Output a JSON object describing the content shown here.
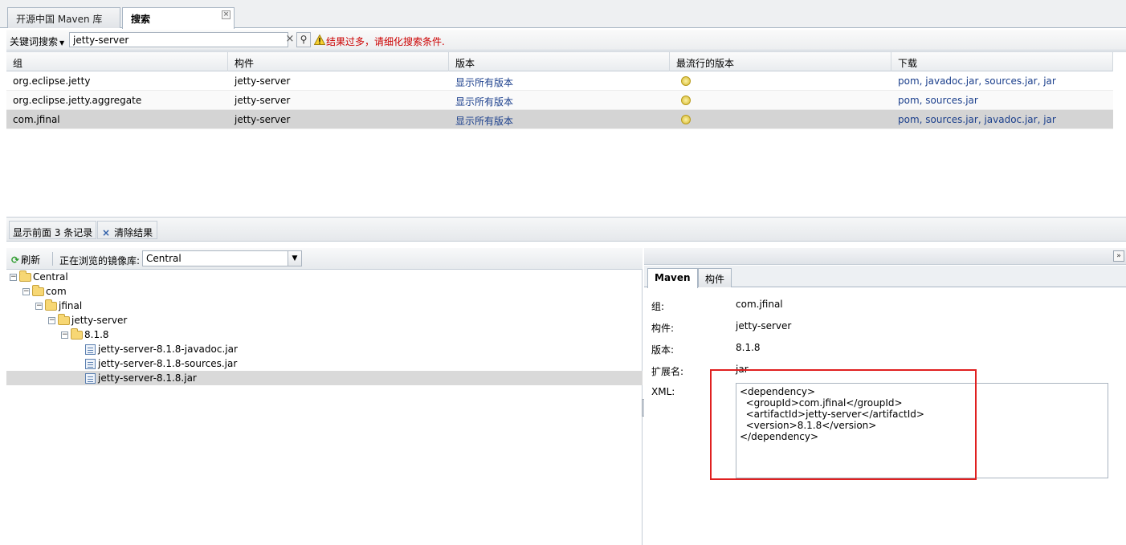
{
  "tabs": [
    {
      "label": "开源中国 Maven 库",
      "active": false
    },
    {
      "label": "搜索",
      "active": true
    }
  ],
  "search": {
    "type_label": "关键词搜索",
    "value": "jetty-server",
    "clear_icon": "×",
    "go_icon": "⚲",
    "warning": "结果过多，请细化搜索条件."
  },
  "grid": {
    "headers": [
      "组",
      "构件",
      "版本",
      "最流行的版本",
      "下载"
    ],
    "rows": [
      {
        "group": "org.eclipse.jetty",
        "artifact": "jetty-server",
        "versions": "显示所有版本",
        "downloads": "pom, javadoc.jar, sources.jar, jar"
      },
      {
        "group": "org.eclipse.jetty.aggregate",
        "artifact": "jetty-server",
        "versions": "显示所有版本",
        "downloads": "pom, sources.jar"
      },
      {
        "group": "com.jfinal",
        "artifact": "jetty-server",
        "versions": "显示所有版本",
        "downloads": "pom, sources.jar, javadoc.jar, jar",
        "selected": true
      }
    ]
  },
  "paging": {
    "count_text": "显示前面 3 条记录",
    "clear_label": "清除结果",
    "clear_icon": "×"
  },
  "tree": {
    "refresh_label": "刷新",
    "refresh_icon": "⟳",
    "repo_label": "正在浏览的镜像库:",
    "repo_value": "Central",
    "toggle_symbol": "−",
    "nodes": [
      "Central",
      "com",
      "jfinal",
      "jetty-server",
      "8.1.8",
      "jetty-server-8.1.8-javadoc.jar",
      "jetty-server-8.1.8-sources.jar",
      "jetty-server-8.1.8.jar"
    ]
  },
  "detail": {
    "collapse_icon": "»",
    "tabs": [
      "Maven",
      "构件"
    ],
    "props": [
      {
        "label": "组:",
        "value": "com.jfinal"
      },
      {
        "label": "构件:",
        "value": "jetty-server"
      },
      {
        "label": "版本:",
        "value": "8.1.8"
      },
      {
        "label": "扩展名:",
        "value": "jar"
      }
    ],
    "xml_label": "XML:",
    "xml": "<dependency>\n  <groupId>com.jfinal</groupId>\n  <artifactId>jetty-server</artifactId>\n  <version>8.1.8</version>\n</dependency>"
  },
  "colors": {
    "warning": "#cc0000",
    "link": "#1b3f8c",
    "highlight": "#e02020",
    "selected_row": "#d4d4d4"
  }
}
